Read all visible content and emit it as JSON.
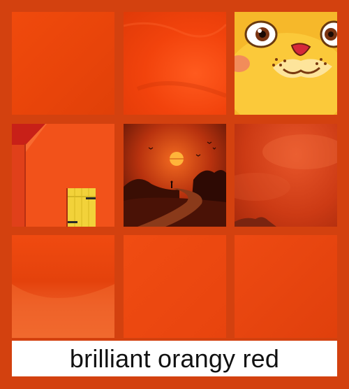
{
  "caption": "brilliant orangy red",
  "colors": {
    "background": "#d3410f",
    "caption_bar": "#ffffff",
    "caption_text": "#111111"
  },
  "tiles": [
    {
      "name": "orange-gradient-texture"
    },
    {
      "name": "red-orange-sky-texture"
    },
    {
      "name": "cartoon-cat-face"
    },
    {
      "name": "orange-wall-with-yellow-door"
    },
    {
      "name": "sunset-path-landscape"
    },
    {
      "name": "red-cloudy-sky"
    },
    {
      "name": "orange-curved-gradient"
    },
    {
      "name": "plain-orange-swatch"
    },
    {
      "name": "plain-red-orange-swatch"
    }
  ]
}
